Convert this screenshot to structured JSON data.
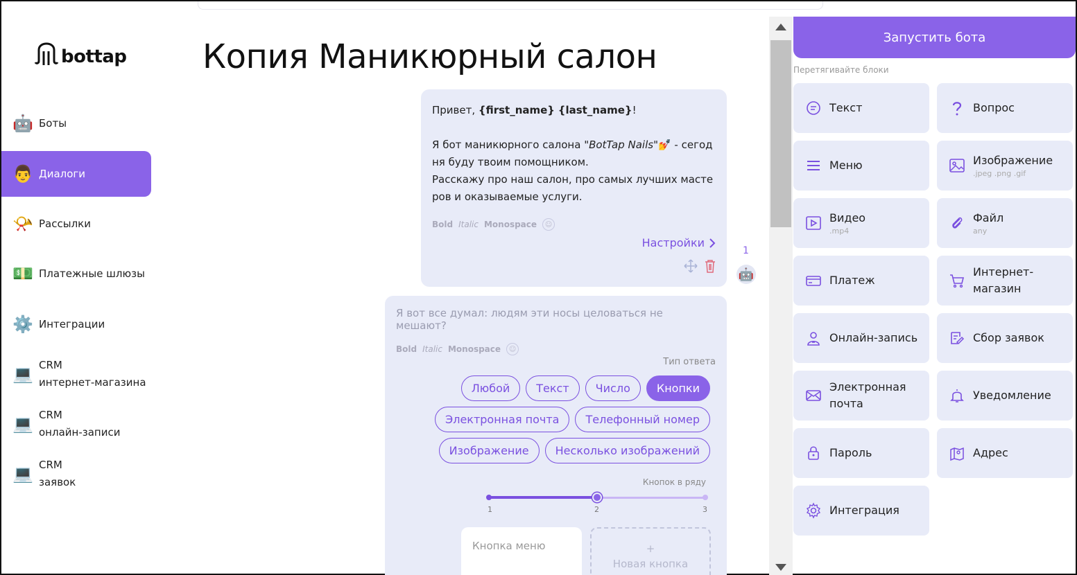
{
  "app": {
    "logo_text": "bottap",
    "page_title": "Копия Маникюрный салон"
  },
  "sidebar": {
    "items": [
      {
        "label": "Боты",
        "icon": "robot-emoji"
      },
      {
        "label": "Диалоги",
        "icon": "person-emoji",
        "active": true
      },
      {
        "label": "Рассылки",
        "icon": "postal-horn-emoji"
      },
      {
        "label": "Платежные шлюзы",
        "icon": "money-emoji"
      },
      {
        "label": "Интеграции",
        "icon": "gear-emoji"
      },
      {
        "label": "CRM",
        "label2": "интернет-магазина",
        "icon": "laptop-emoji"
      },
      {
        "label": "CRM",
        "label2": "онлайн-записи",
        "icon": "laptop-emoji"
      },
      {
        "label": "CRM",
        "label2": "заявок",
        "icon": "laptop-emoji"
      }
    ]
  },
  "message1": {
    "greet_prefix": "Привет, ",
    "first_name": "{first_name}",
    "last_name": "{last_name}",
    "greet_suffix": "!",
    "line1_prefix": "Я бот маникюрного салона ",
    "salon_name": "\"BotTap Nails\"",
    "line1_suffix": "  - сегод",
    "line2": "ня буду твоим помощником.",
    "line3": "Расскажу про наш салон, про самых лучших масте",
    "line4": "ров и оказываемые услуги.",
    "fmt_bold": "Bold",
    "fmt_italic": "Italic",
    "fmt_mono": "Monospace",
    "settings_label": "Настройки",
    "step_number": "1"
  },
  "message2": {
    "question": "Я вот все думал: людям эти носы целоваться не мешают?",
    "fmt_bold": "Bold",
    "fmt_italic": "Italic",
    "fmt_mono": "Monospace",
    "answer_type_label": "Тип ответа",
    "answer_types": [
      {
        "label": "Любой",
        "selected": false
      },
      {
        "label": "Текст",
        "selected": false
      },
      {
        "label": "Число",
        "selected": false
      },
      {
        "label": "Кнопки",
        "selected": true
      },
      {
        "label": "Электронная почта",
        "selected": false
      },
      {
        "label": "Телефонный номер",
        "selected": false
      },
      {
        "label": "Изображение",
        "selected": false
      },
      {
        "label": "Несколько изображений",
        "selected": false
      }
    ],
    "buttons_per_row_label": "Кнопок в ряду",
    "slider": {
      "min": 1,
      "max": 3,
      "value": 2,
      "ticks": [
        "1",
        "2",
        "3"
      ]
    },
    "menu_button_placeholder": "Кнопка меню",
    "new_button_plus": "+",
    "new_button_label": "Новая кнопка"
  },
  "right_panel": {
    "launch_label": "Запустить бота",
    "drag_hint": "Перетягивайте блоки",
    "blocks": [
      {
        "label": "Текст",
        "sub": "",
        "icon": "chat-icon"
      },
      {
        "label": "Вопрос",
        "sub": "",
        "icon": "question-icon"
      },
      {
        "label": "Меню",
        "sub": "",
        "icon": "menu-icon"
      },
      {
        "label": "Изображение",
        "sub": ".jpeg .png .gif",
        "icon": "image-icon"
      },
      {
        "label": "Видео",
        "sub": ".mp4",
        "icon": "video-icon"
      },
      {
        "label": "Файл",
        "sub": "any",
        "icon": "paperclip-icon"
      },
      {
        "label": "Платеж",
        "sub": "",
        "icon": "card-icon"
      },
      {
        "label": "Интернет-магазин",
        "label_line1": "Интернет-",
        "label_line2": "магазин",
        "sub": "",
        "icon": "cart-icon"
      },
      {
        "label": "Онлайн-запись",
        "sub": "",
        "icon": "person-badge-icon"
      },
      {
        "label": "Сбор заявок",
        "sub": "",
        "icon": "form-edit-icon"
      },
      {
        "label": "Электронная почта",
        "label_line1": "Электронная",
        "label_line2": "почта",
        "sub": "",
        "icon": "mail-icon"
      },
      {
        "label": "Уведомление",
        "sub": "",
        "icon": "bell-icon"
      },
      {
        "label": "Пароль",
        "sub": "",
        "icon": "lock-icon"
      },
      {
        "label": "Адрес",
        "sub": "",
        "icon": "map-pin-icon"
      },
      {
        "label": "Интеграция",
        "sub": "",
        "icon": "gear-icon"
      }
    ]
  },
  "colors": {
    "accent": "#8a63e8",
    "accent_dark": "#7a50e0",
    "bubble_bg": "#e8ebf8"
  }
}
